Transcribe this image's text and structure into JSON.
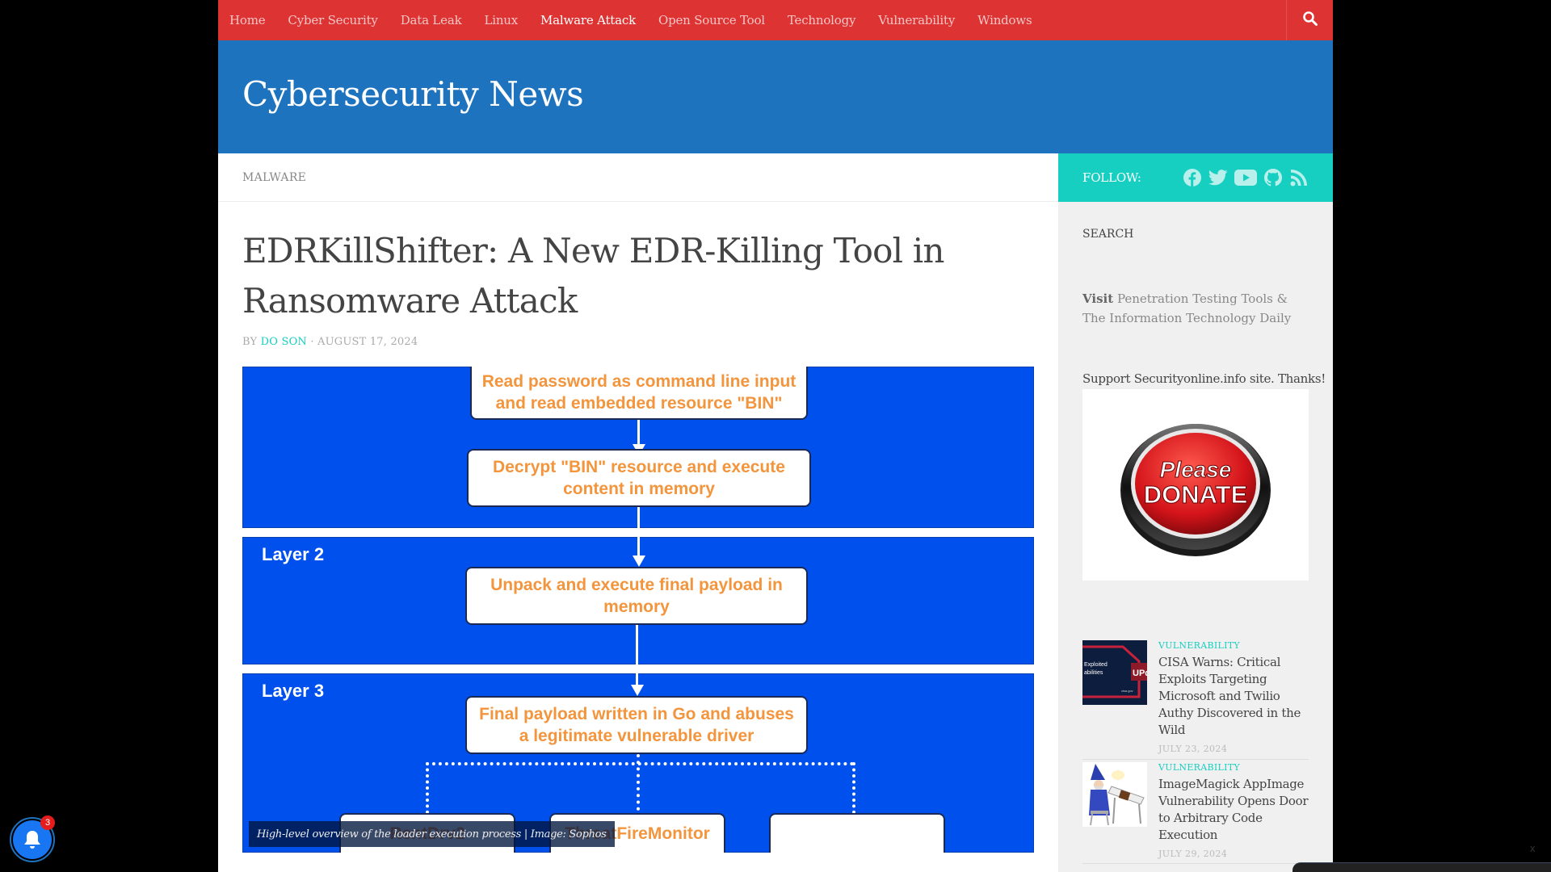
{
  "nav": {
    "items": [
      {
        "label": "Home",
        "active": false
      },
      {
        "label": "Cyber Security",
        "active": false
      },
      {
        "label": "Data Leak",
        "active": false
      },
      {
        "label": "Linux",
        "active": false
      },
      {
        "label": "Malware Attack",
        "active": true
      },
      {
        "label": "Open Source Tool",
        "active": false
      },
      {
        "label": "Technology",
        "active": false
      },
      {
        "label": "Vulnerability",
        "active": false
      },
      {
        "label": "Windows",
        "active": false
      }
    ],
    "search_icon": "search-icon"
  },
  "header": {
    "site_title": "Cybersecurity News"
  },
  "colors": {
    "nav_bg": "#dd3333",
    "header_bg": "#1e73be",
    "accent_teal": "#16cfc1",
    "sidebar_bg": "#f0f0f0",
    "diagram_blue": "#0050ee",
    "diagram_text": "#f3953d"
  },
  "article": {
    "category": "MALWARE",
    "title": "EDRKillShifter: A New EDR-Killing Tool in Ransomware Attack",
    "byline_prefix": "BY",
    "author": "DO SON",
    "separator": "·",
    "date": "AUGUST 17, 2024",
    "figure": {
      "boxes": [
        "Read password as command line input and read embedded resource \"BIN\"",
        "Decrypt \"BIN\" resource and execute content in memory",
        "Unpack and execute final payload in memory",
        "Final payload written in Go and abuses a legitimate vulnerable driver",
        "RentDrv2",
        "ThreatFireMonitor",
        ""
      ],
      "layers": [
        "Layer 2",
        "Layer 3"
      ],
      "caption": "High-level overview of the loader execution process | Image: Sophos"
    }
  },
  "sidebar": {
    "follow_label": "FOLLOW:",
    "social_icons": [
      "facebook-icon",
      "twitter-icon",
      "youtube-icon",
      "github-icon",
      "rss-icon"
    ],
    "search_title": "SEARCH",
    "visit_bold": "Visit",
    "visit_text": "Penetration Testing Tools & The Information Technology Daily",
    "support_text": "Support Securityonline.info site. Thanks!",
    "donate_line1": "Please",
    "donate_line2": "DONATE",
    "posts": [
      {
        "category": "VULNERABILITY",
        "title": "CISA Warns: Critical Exploits Targeting Microsoft and Twilio Authy Discovered in the Wild",
        "date": "JULY 23, 2024",
        "thumb_text_1": "Exploited",
        "thumb_text_2": "abilities",
        "thumb_badge": "UPd",
        "thumb_footer": "cisa.gov"
      },
      {
        "category": "VULNERABILITY",
        "title": "ImageMagick AppImage Vulnerability Opens Door to Arbitrary Code Execution",
        "date": "JULY 29, 2024"
      }
    ]
  },
  "notifications": {
    "badge_count": "3"
  },
  "overlay": {
    "close_label": "x"
  }
}
